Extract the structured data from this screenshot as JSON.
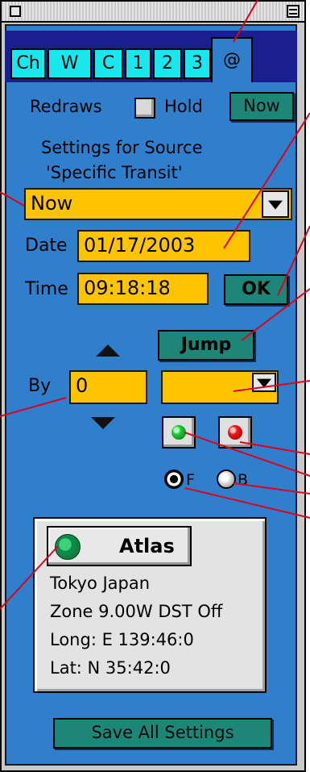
{
  "tabs": [
    "Ch",
    "W",
    "C",
    "1",
    "2",
    "3",
    "@"
  ],
  "redraws": {
    "label": "Redraws",
    "hold_label": "Hold",
    "hold_checked": false,
    "now_button": "Now"
  },
  "settings_caption_line1": "Settings for Source",
  "settings_caption_line2": "'Specific Transit'",
  "source_select": {
    "value": "Now"
  },
  "date": {
    "label": "Date",
    "value": "01/17/2003"
  },
  "time": {
    "label": "Time",
    "value": "09:18:18"
  },
  "ok_button": "OK",
  "jump_button": "Jump",
  "step": {
    "label": "By",
    "value": "0",
    "unit_value": ""
  },
  "direction": {
    "forward_label": "F",
    "backward_label": "B",
    "selected": "F"
  },
  "location": {
    "atlas_button": "Atlas",
    "place": "Tokyo  Japan",
    "zone": "Zone 9.00W  DST Off",
    "longitude": "Long: E 139:46:0",
    "latitude": "Lat: N 35:42:0"
  },
  "save_button": "Save All Settings",
  "colors": {
    "panel": "#2f7fcc",
    "field": "#ffc400",
    "teal_button": "#1d8679",
    "tab": "#19e7ee",
    "tab_strip": "#1a1f8f",
    "leader": "#e0001b"
  },
  "icons": [
    "close-box-icon",
    "zoom-box-icon",
    "up-triangle-icon",
    "down-triangle-icon",
    "dropdown-arrow-icon",
    "green-ball-icon",
    "red-ball-icon",
    "globe-icon"
  ]
}
